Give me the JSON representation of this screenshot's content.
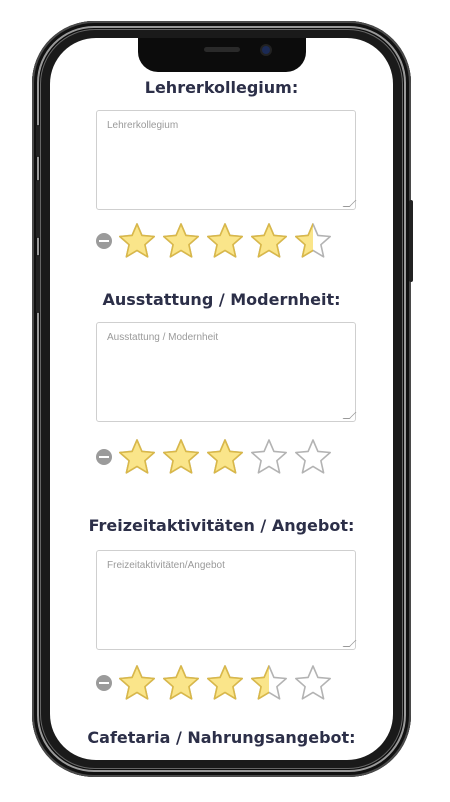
{
  "sections": [
    {
      "title": "Lehrerkollegium:",
      "placeholder": "Lehrerkollegium",
      "rating": 4.5
    },
    {
      "title": "Ausstattung / Modernheit:",
      "placeholder": "Ausstattung / Modernheit",
      "rating": 3
    },
    {
      "title": "Freizeitaktivitäten / Angebot:",
      "placeholder": "Freizeitaktivitäten/Angebot",
      "rating": 3.5
    },
    {
      "title": "Cafetaria / Nahrungsangebot:"
    }
  ],
  "colors": {
    "star_fill": "#fae58a",
    "star_stroke": "#d9b84a",
    "star_empty_stroke": "#b3b3b3",
    "heading": "#2c2f48"
  },
  "max_stars": 5
}
